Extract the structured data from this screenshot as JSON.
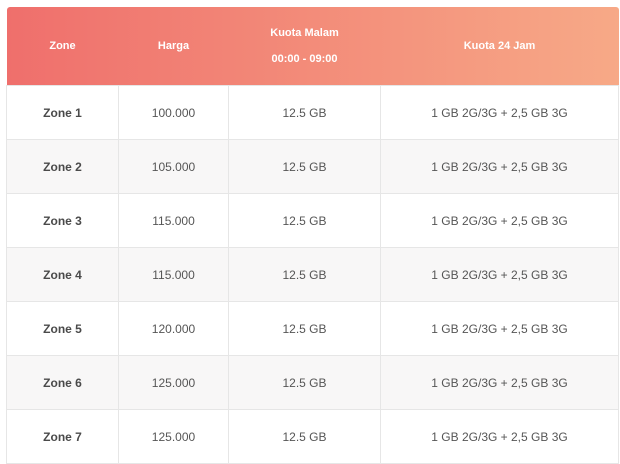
{
  "table": {
    "headers": [
      "Zone",
      "Harga",
      "Kuota Malam",
      "00:00 - 09:00",
      "Kuota 24 Jam"
    ],
    "rows": [
      {
        "zone": "Zone 1",
        "harga": "100.000",
        "malam": "12.5 GB",
        "full": "1 GB 2G/3G + 2,5 GB 3G"
      },
      {
        "zone": "Zone 2",
        "harga": "105.000",
        "malam": "12.5 GB",
        "full": "1 GB 2G/3G + 2,5 GB 3G"
      },
      {
        "zone": "Zone 3",
        "harga": "115.000",
        "malam": "12.5 GB",
        "full": "1 GB 2G/3G + 2,5 GB 3G"
      },
      {
        "zone": "Zone 4",
        "harga": "115.000",
        "malam": "12.5 GB",
        "full": "1 GB 2G/3G + 2,5 GB 3G"
      },
      {
        "zone": "Zone 5",
        "harga": "120.000",
        "malam": "12.5 GB",
        "full": "1 GB 2G/3G + 2,5 GB 3G"
      },
      {
        "zone": "Zone 6",
        "harga": "125.000",
        "malam": "12.5 GB",
        "full": "1 GB 2G/3G + 2,5 GB 3G"
      },
      {
        "zone": "Zone 7",
        "harga": "125.000",
        "malam": "12.5 GB",
        "full": "1 GB 2G/3G + 2,5 GB 3G"
      }
    ]
  },
  "colors": {
    "header_gradient_start": "#ef6f6c",
    "header_gradient_end": "#f7a987",
    "row_stripe": "#f8f7f7"
  }
}
